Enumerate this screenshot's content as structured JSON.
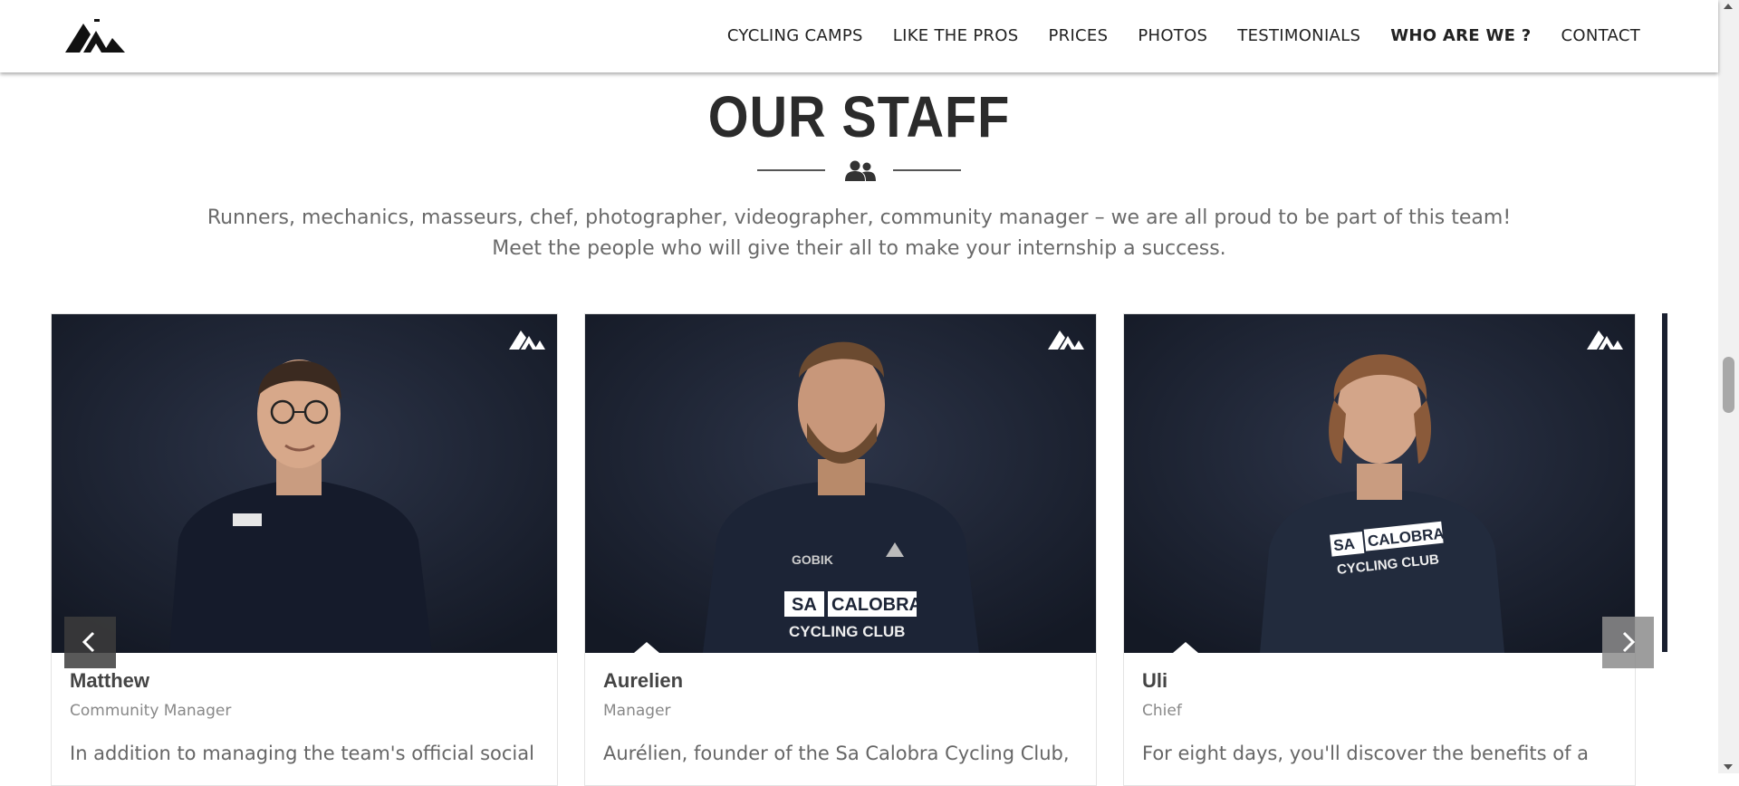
{
  "nav": {
    "items": [
      {
        "label": "CYCLING CAMPS"
      },
      {
        "label": "LIKE THE PROS"
      },
      {
        "label": "PRICES"
      },
      {
        "label": "PHOTOS"
      },
      {
        "label": "TESTIMONIALS"
      },
      {
        "label": "WHO ARE WE ?"
      },
      {
        "label": "CONTACT"
      }
    ],
    "active": "WHO ARE WE ?"
  },
  "section": {
    "title": "OUR STAFF",
    "icon": "users-icon",
    "intro": "Runners, mechanics, masseurs, chef, photographer, videographer, community manager – we are all proud to be part of this team! Meet the people who will give their all to make your internship a success."
  },
  "staff": [
    {
      "name": "Matthew",
      "role": "Community Manager",
      "desc": "In addition to managing the team's official social"
    },
    {
      "name": "Aurelien",
      "role": "Manager",
      "desc": "Aurélien, founder of the Sa Calobra Cycling Club,"
    },
    {
      "name": "Uli",
      "role": "Chief",
      "desc": "For eight days, you'll discover the benefits of a"
    }
  ],
  "jersey_text": {
    "line1a": "SA",
    "line1b": "CALOBRA",
    "line2": "CYCLING CLUB",
    "sponsor": "GOBIK"
  },
  "colors": {
    "photo_bg": "#1a2030",
    "title": "#2b2b2b",
    "text": "#6a6a6a",
    "arrow": "#8c8c8c"
  }
}
